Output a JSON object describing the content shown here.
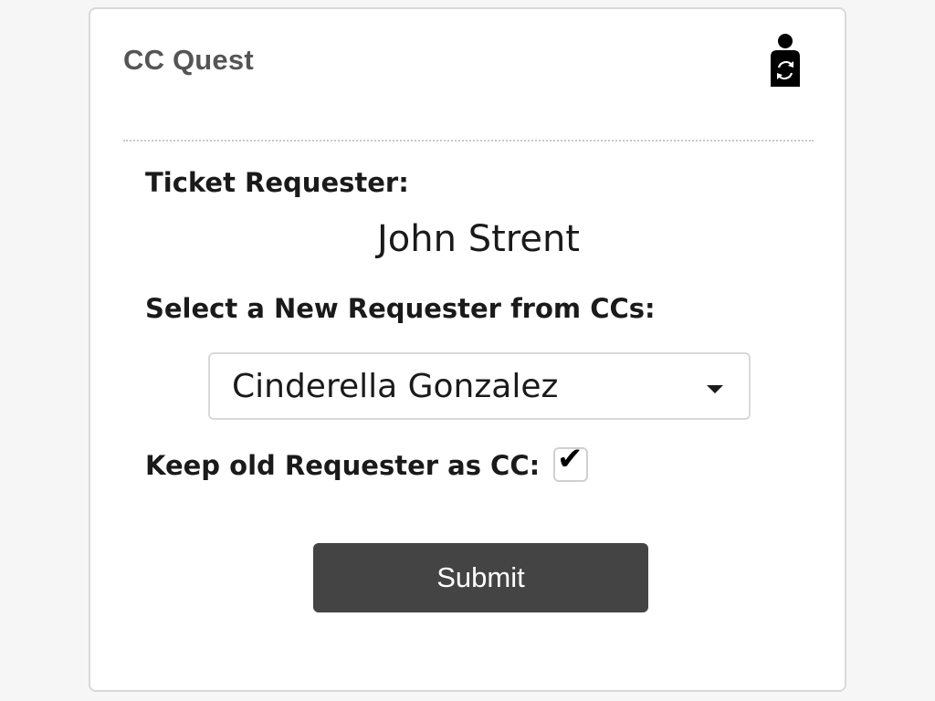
{
  "app": {
    "title": "CC Quest",
    "icon": "person-swap-icon"
  },
  "ticket": {
    "requester_label": "Ticket Requester:",
    "requester_name": "John Strent"
  },
  "new_requester": {
    "label": "Select a New Requester from CCs:",
    "selected": "Cinderella Gonzalez"
  },
  "keep_old": {
    "label": "Keep old Requester as CC:",
    "checked": true,
    "check_glyph": "✔"
  },
  "submit": {
    "label": "Submit"
  },
  "colors": {
    "page_background": "#f6f6f6",
    "card_background": "#ffffff",
    "button_background": "#444444",
    "title_text": "#555555"
  }
}
